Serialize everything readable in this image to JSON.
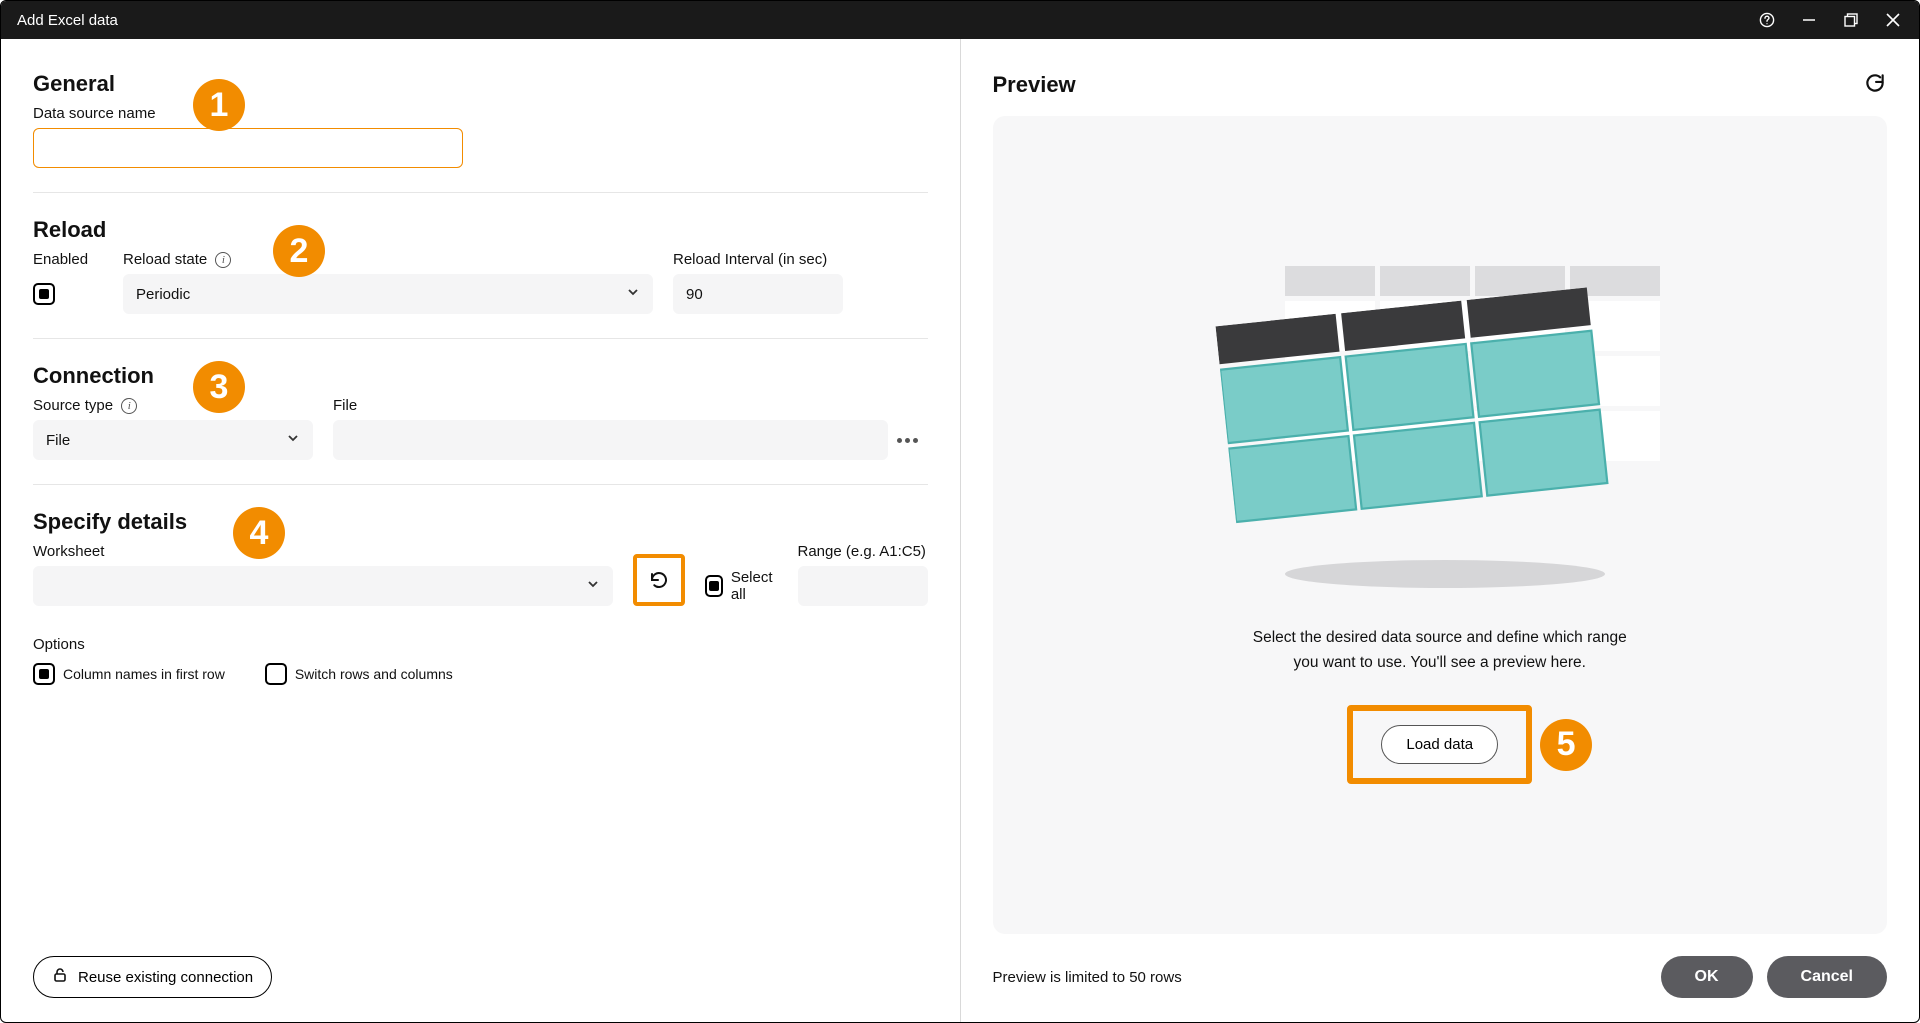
{
  "titlebar": {
    "title": "Add Excel data"
  },
  "sections": {
    "general": {
      "heading": "General",
      "data_source_name_label": "Data source name",
      "data_source_name_value": ""
    },
    "reload": {
      "heading": "Reload",
      "enabled_label": "Enabled",
      "reload_state_label": "Reload state",
      "reload_state_value": "Periodic",
      "reload_interval_label": "Reload Interval (in sec)",
      "reload_interval_value": "90"
    },
    "connection": {
      "heading": "Connection",
      "source_type_label": "Source type",
      "source_type_value": "File",
      "file_label": "File",
      "file_value": ""
    },
    "specify": {
      "heading": "Specify details",
      "worksheet_label": "Worksheet",
      "worksheet_value": "",
      "select_all_label": "Select all",
      "range_label": "Range (e.g. A1:C5)",
      "range_value": "",
      "options_label": "Options",
      "column_names_label": "Column names in first row",
      "switch_rows_label": "Switch rows and columns"
    }
  },
  "reuse_button": "Reuse existing connection",
  "preview": {
    "heading": "Preview",
    "message_l1": "Select the desired data source and define which range",
    "message_l2": "you want to use. You'll see a preview here.",
    "load_button": "Load data",
    "limit_text": "Preview is limited to 50 rows"
  },
  "footer": {
    "ok": "OK",
    "cancel": "Cancel"
  },
  "annotations": {
    "b1": "1",
    "b2": "2",
    "b3": "3",
    "b4": "4",
    "b5": "5"
  }
}
